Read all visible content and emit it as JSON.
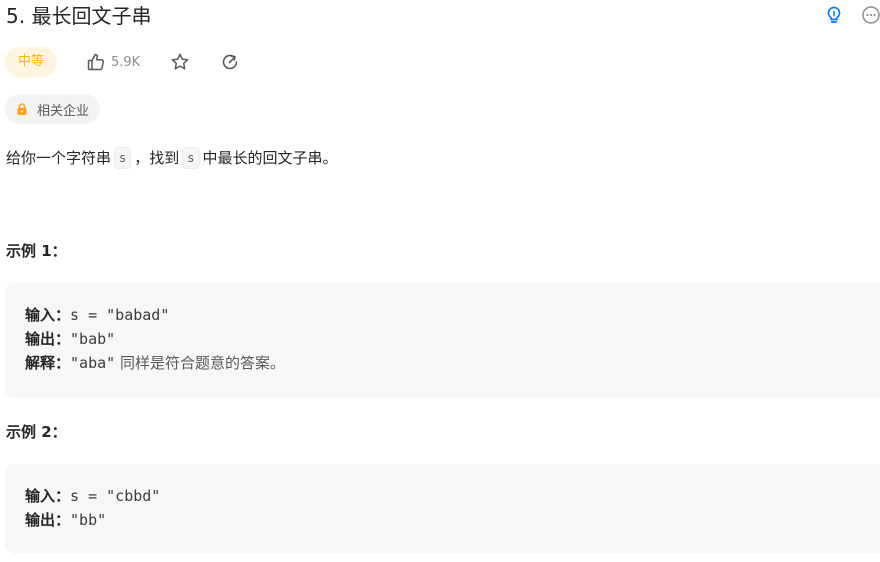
{
  "problem": {
    "title": "5. 最长回文子串",
    "difficulty": "中等",
    "likes": "5.9K",
    "companies_label": "相关企业"
  },
  "description": {
    "part1": "给你一个字符串",
    "var1": "s",
    "part2": "，找到",
    "var2": "s",
    "part3": "中最长的回文子串。"
  },
  "examples": [
    {
      "title": "示例 1：",
      "input_label": "输入：",
      "input_value": "s = \"babad\"",
      "output_label": "输出：",
      "output_value": "\"bab\"",
      "explain_label": "解释：",
      "explain_value": "\"aba\"",
      "explain_text": "同样是符合题意的答案。"
    },
    {
      "title": "示例 2：",
      "input_label": "输入：",
      "input_value": "s = \"cbbd\"",
      "output_label": "输出：",
      "output_value": "\"bb\""
    }
  ],
  "icons": {
    "hint": "lightbulb-icon",
    "more": "more-options-icon",
    "like": "thumbs-up-icon",
    "favorite": "star-icon",
    "share": "share-icon",
    "lock": "lock-icon"
  },
  "colors": {
    "difficulty_text": "#ffb800",
    "difficulty_bg": "#fff4e0",
    "hint_icon": "#007aff",
    "lock_icon": "#ffa116"
  }
}
